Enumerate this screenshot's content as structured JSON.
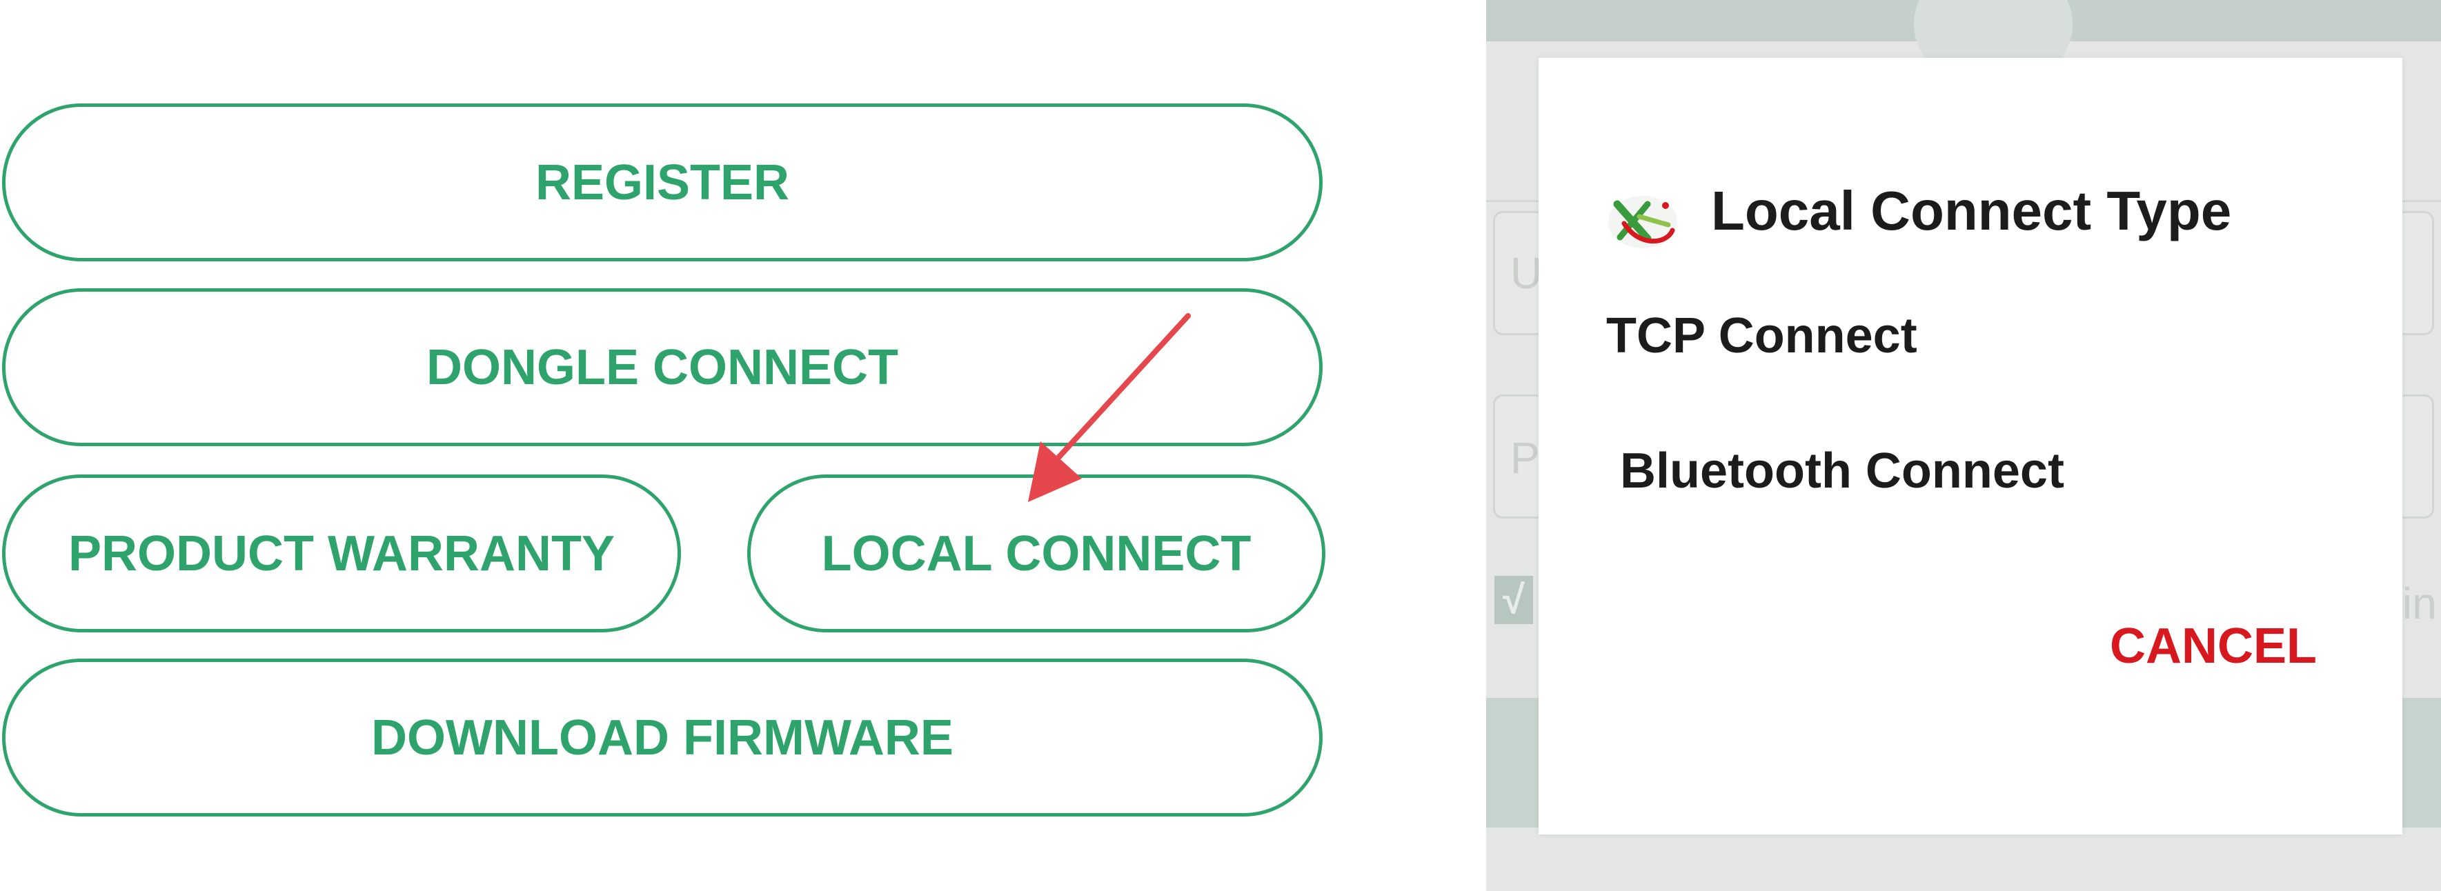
{
  "left_panel": {
    "buttons": {
      "register": "REGISTER",
      "dongle_connect": "DONGLE CONNECT",
      "product_warranty": "PRODUCT WARRANTY",
      "local_connect": "LOCAL CONNECT",
      "download_firmware": "DOWNLOAD FIRMWARE"
    },
    "accent_color": "#2ea36b",
    "annotation_arrow_color": "#e5474d"
  },
  "background_screen": {
    "field_1_letter": "U",
    "field_2_letter": "P",
    "checkbox_mark": "√",
    "right_edge_text": "in"
  },
  "dialog": {
    "icon": "app-logo-icon",
    "title": "Local Connect Type",
    "options": [
      "TCP Connect",
      "Bluetooth Connect"
    ],
    "cancel_label": "CANCEL",
    "cancel_color": "#d7191f"
  }
}
